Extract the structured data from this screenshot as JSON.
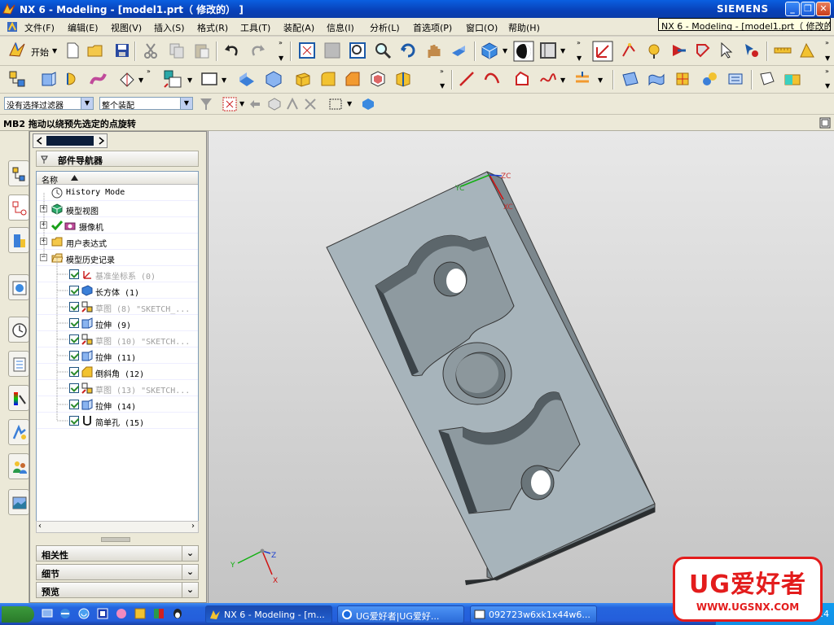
{
  "window": {
    "title": "NX 6 - Modeling - [model1.prt（ 修改的） ]",
    "brand": "SIEMENS",
    "tooltip": "NX 6 - Modeling - [model1.prt（ 修改的） ]"
  },
  "menu": [
    "文件(F)",
    "编辑(E)",
    "视图(V)",
    "插入(S)",
    "格式(R)",
    "工具(T)",
    "装配(A)",
    "信息(I)",
    "分析(L)",
    "首选项(P)",
    "窗口(O)",
    "帮助(H)"
  ],
  "toolbar": {
    "start_label": "开始",
    "filter_combo": "没有选择过滤器",
    "scope_combo": "整个装配"
  },
  "cue": "MB2 拖动以绕预先选定的点旋转",
  "navigator": {
    "title": "部件导航器",
    "column": "名称",
    "items": [
      {
        "label": "History Mode",
        "dim": false
      },
      {
        "label": "模型视图",
        "dim": false
      },
      {
        "label": "摄像机",
        "dim": false
      },
      {
        "label": "用户表达式",
        "dim": false
      },
      {
        "label": "模型历史记录",
        "dim": false
      },
      {
        "label": "基准坐标系 (0)",
        "dim": true
      },
      {
        "label": "长方体 (1)",
        "dim": false
      },
      {
        "label": "草图 (8) \"SKETCH_...",
        "dim": true
      },
      {
        "label": "拉伸 (9)",
        "dim": false
      },
      {
        "label": "草图 (10) \"SKETCH...",
        "dim": true
      },
      {
        "label": "拉伸 (11)",
        "dim": false
      },
      {
        "label": "倒斜角 (12)",
        "dim": false
      },
      {
        "label": "草图 (13) \"SKETCH...",
        "dim": true
      },
      {
        "label": "拉伸 (14)",
        "dim": false
      },
      {
        "label": "简单孔 (15)",
        "dim": false
      }
    ],
    "panels": [
      "相关性",
      "细节",
      "预览"
    ]
  },
  "viewport": {
    "wcs_labels": {
      "zc": "ZC",
      "xc": "XC",
      "yc": "YC"
    },
    "abs_labels": {
      "z": "Z",
      "x": "X",
      "y": "Y"
    }
  },
  "taskbar": {
    "tasks": [
      "NX 6 - Modeling - [m...",
      "UG爱好者|UG爱好...",
      "092723w6xk1x44w6..."
    ],
    "clock": "21:4"
  },
  "watermark": {
    "title": "UG爱好者",
    "url": "WWW.UGSNX.COM"
  },
  "colors": {
    "title": "#0a4fd0",
    "chrome": "#ece9d8",
    "part": "#a7b4bb",
    "watermark": "#e31c1c"
  }
}
